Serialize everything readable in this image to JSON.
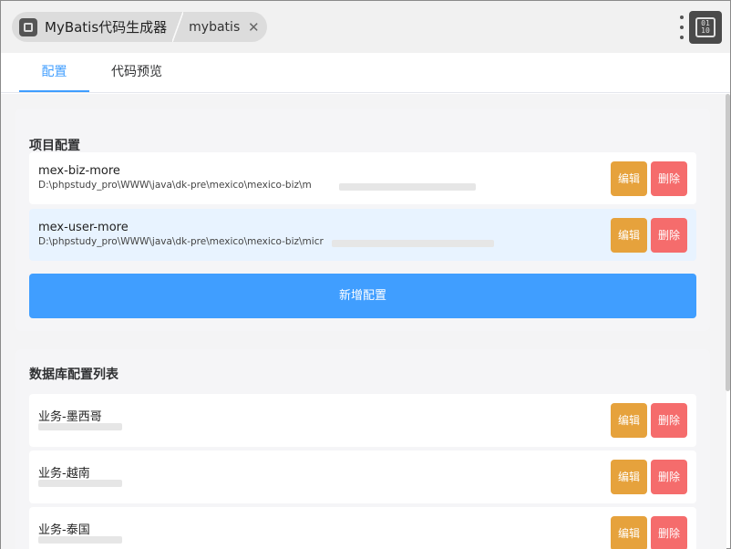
{
  "window": {
    "app_title": "MyBatis代码生成器",
    "tab_name": "mybatis",
    "close_glyph": "✕",
    "corner_glyph": "01\n10"
  },
  "tabs": [
    {
      "label": "配置",
      "active": true
    },
    {
      "label": "代码预览",
      "active": false
    }
  ],
  "project_config": {
    "title": "项目配置",
    "items": [
      {
        "name": "mex-biz-more",
        "path": "D:\\phpstudy_pro\\WWW\\java\\dk-pre\\mexico\\mexico-biz\\m"
      },
      {
        "name": "mex-user-more",
        "path": "D:\\phpstudy_pro\\WWW\\java\\dk-pre\\mexico\\mexico-biz\\micr"
      }
    ],
    "add_label": "新增配置"
  },
  "db_config": {
    "title": "数据库配置列表",
    "items": [
      {
        "name": "业务-墨西哥"
      },
      {
        "name": "业务-越南"
      },
      {
        "name": "业务-泰国"
      }
    ]
  },
  "buttons": {
    "edit_label": "编辑",
    "delete_label": "删除"
  },
  "colors": {
    "accent": "#409eff",
    "edit": "#e6a23c",
    "delete": "#f56c6c"
  },
  "icons": {
    "app": "app-icon",
    "menu": "more-vertical-icon",
    "corner": "binary-icon",
    "close": "close-icon"
  }
}
